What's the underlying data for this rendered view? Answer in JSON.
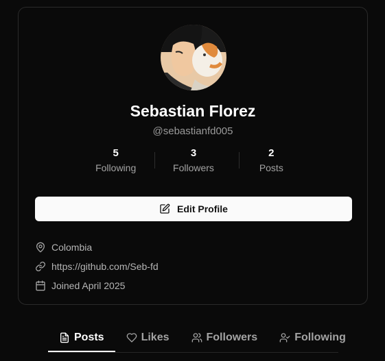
{
  "profile": {
    "name": "Sebastian Florez",
    "handle": "@sebastianfd005",
    "avatar_icon": "profile-avatar-illustration"
  },
  "stats": [
    {
      "value": "5",
      "label": "Following"
    },
    {
      "value": "3",
      "label": "Followers"
    },
    {
      "value": "2",
      "label": "Posts"
    }
  ],
  "edit_button": {
    "label": "Edit Profile",
    "icon": "pencil-square-icon"
  },
  "info": {
    "location": "Colombia",
    "website": "https://github.com/Seb-fd",
    "joined": "Joined April 2025"
  },
  "tabs": [
    {
      "label": "Posts",
      "icon": "document-icon",
      "active": true
    },
    {
      "label": "Likes",
      "icon": "heart-icon",
      "active": false
    },
    {
      "label": "Followers",
      "icon": "users-icon",
      "active": false
    },
    {
      "label": "Following",
      "icon": "user-check-icon",
      "active": false
    }
  ],
  "colors": {
    "background": "#0a0a0a",
    "card_border": "#2a2a2a",
    "button_bg": "#fafafa",
    "muted_text": "#a3a3a3"
  }
}
